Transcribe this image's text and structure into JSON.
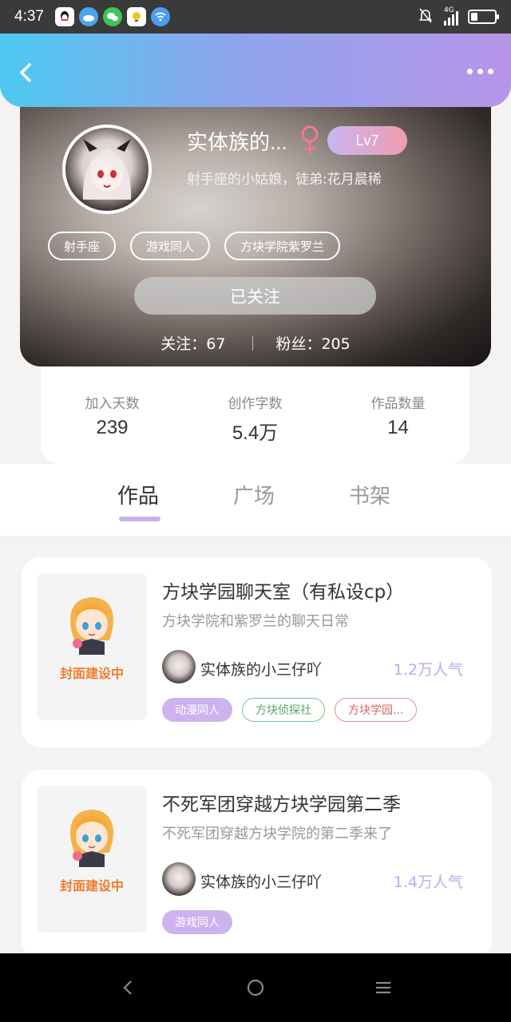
{
  "status_bar": {
    "time": "4:37",
    "notification_icons": [
      "qq-icon",
      "weibo-icon",
      "wechat-icon",
      "bulletin-icon",
      "wifi-icon"
    ],
    "signal_label": "4G",
    "battery_level": 0.3
  },
  "header": {
    "back_icon": "chevron-left-icon",
    "more_icon": "more-dots-icon"
  },
  "profile": {
    "nickname": "实体族的...",
    "gender_icon": "female-symbol-icon",
    "gender_color": "#f07a90",
    "level": "Lv7",
    "bio": "射手座的小姑娘，徒弟:花月晨稀",
    "tags": [
      "射手座",
      "游戏同人",
      "方块学院紫罗兰"
    ],
    "follow_button": "已关注",
    "following": "关注：67",
    "followers": "粉丝：205"
  },
  "stats": [
    {
      "label": "加入天数",
      "value": "239"
    },
    {
      "label": "创作字数",
      "value": "5.4万"
    },
    {
      "label": "作品数量",
      "value": "14"
    }
  ],
  "tabs": [
    {
      "label": "作品",
      "active": true
    },
    {
      "label": "广场",
      "active": false
    },
    {
      "label": "书架",
      "active": false
    }
  ],
  "works": [
    {
      "cover_text": "封面建设中",
      "title": "方块学园聊天室（有私设cp）",
      "desc": "方块学院和紫罗兰的聊天日常",
      "author": "实体族的小三仔吖",
      "popularity": "1.2万人气",
      "tags": [
        {
          "label": "动漫同人",
          "style": "filled"
        },
        {
          "label": "方块侦探社",
          "style": "green"
        },
        {
          "label": "方块学园...",
          "style": "red"
        }
      ]
    },
    {
      "cover_text": "封面建设中",
      "title": "不死军团穿越方块学园第二季",
      "desc": "不死军团穿越方块学院的第二季来了",
      "author": "实体族的小三仔吖",
      "popularity": "1.4万人气",
      "tags": [
        {
          "label": "游戏同人",
          "style": "filled"
        }
      ]
    }
  ],
  "nav_bar": {
    "icons": [
      "back-triangle-icon",
      "home-circle-icon",
      "menu-lines-icon"
    ]
  },
  "colors": {
    "accent_purple": "#c6b1ea",
    "header_gradient_start": "#4cc9f0",
    "header_gradient_end": "#b795e8"
  }
}
